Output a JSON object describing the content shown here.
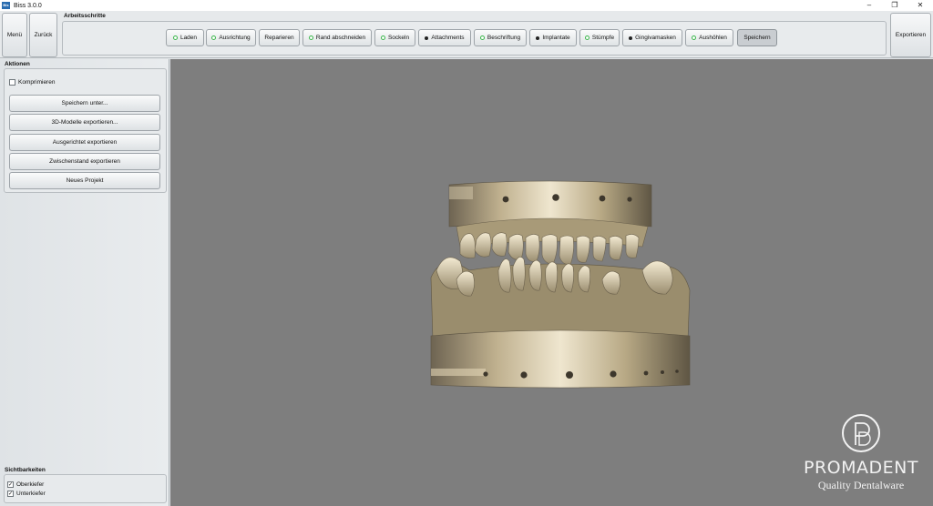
{
  "window": {
    "title": "Biss 3.0.0",
    "app_icon_text": "Bis"
  },
  "toolbar": {
    "menu_label": "Menü",
    "back_label": "Zurück",
    "export_label": "Exportieren",
    "steps_title": "Arbeitsschritte",
    "steps": [
      {
        "label": "Laden",
        "indicator": "green"
      },
      {
        "label": "Ausrichtung",
        "indicator": "green"
      },
      {
        "label": "Reparieren",
        "indicator": "none"
      },
      {
        "label": "Rand abschneiden",
        "indicator": "green"
      },
      {
        "label": "Sockeln",
        "indicator": "green"
      },
      {
        "label": "Attachments",
        "indicator": "black"
      },
      {
        "label": "Beschriftung",
        "indicator": "green"
      },
      {
        "label": "Implantate",
        "indicator": "black"
      },
      {
        "label": "Stümpfe",
        "indicator": "green"
      },
      {
        "label": "Gingivamasken",
        "indicator": "black"
      },
      {
        "label": "Aushöhlen",
        "indicator": "green"
      },
      {
        "label": "Speichern",
        "indicator": "none",
        "active": true
      }
    ]
  },
  "actions": {
    "title": "Aktionen",
    "compress_label": "Komprimieren",
    "compress_checked": false,
    "buttons": [
      "Speichern unter...",
      "3D-Modelle exportieren...",
      "Ausgerichtet exportieren",
      "Zwischenstand exportieren",
      "Neues Projekt"
    ]
  },
  "visibility": {
    "title": "Sichtbarkeiten",
    "items": [
      {
        "label": "Oberkiefer",
        "checked": true
      },
      {
        "label": "Unterkiefer",
        "checked": true
      }
    ]
  },
  "branding": {
    "name": "PROMADENT",
    "tagline": "Quality Dentalware",
    "monogram": "PD"
  },
  "colors": {
    "viewport": "#7e7e7e",
    "model": "#c8b998",
    "indicator_green": "#39b54a"
  }
}
